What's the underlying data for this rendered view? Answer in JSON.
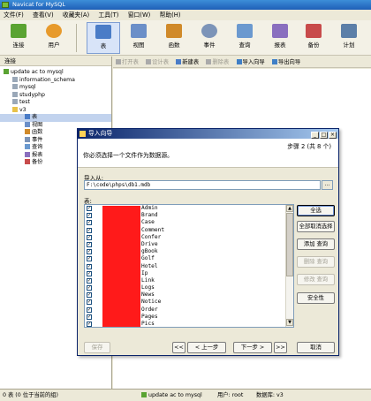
{
  "window": {
    "title": "Navicat for MySQL"
  },
  "menu": [
    "文件(F)",
    "查看(V)",
    "收藏夹(A)",
    "工具(T)",
    "窗口(W)",
    "帮助(H)"
  ],
  "toolbar": {
    "buttons": [
      {
        "label": "连接",
        "icon": "plug-icon",
        "color": "#5aa332"
      },
      {
        "label": "用户",
        "icon": "user-icon",
        "color": "#e79a2c"
      },
      {
        "label": "表",
        "icon": "table-icon",
        "color": "#4a7cc7"
      },
      {
        "label": "视图",
        "icon": "view-icon",
        "color": "#6b8fc8"
      },
      {
        "label": "函数",
        "icon": "function-icon",
        "color": "#d08a2a"
      },
      {
        "label": "事件",
        "icon": "event-icon",
        "color": "#7c94b8"
      },
      {
        "label": "查询",
        "icon": "query-icon",
        "color": "#6b99cf"
      },
      {
        "label": "报表",
        "icon": "report-icon",
        "color": "#8a6fbf"
      },
      {
        "label": "备份",
        "icon": "backup-icon",
        "color": "#c84b4b"
      },
      {
        "label": "计划",
        "icon": "schedule-icon",
        "color": "#5c7fa8"
      }
    ]
  },
  "left_pane": {
    "header": "连接",
    "tree": [
      {
        "label": "update ac to mysql",
        "level": 0
      },
      {
        "label": "information_schema",
        "level": 1
      },
      {
        "label": "mysql",
        "level": 1
      },
      {
        "label": "studyphp",
        "level": 1
      },
      {
        "label": "test",
        "level": 1
      },
      {
        "label": "v3",
        "level": 1
      },
      {
        "label": "表",
        "level": 2
      },
      {
        "label": "视图",
        "level": 2
      },
      {
        "label": "函数",
        "level": 2
      },
      {
        "label": "事件",
        "level": 2
      },
      {
        "label": "查询",
        "level": 2
      },
      {
        "label": "报表",
        "level": 2
      },
      {
        "label": "备份",
        "level": 2
      }
    ]
  },
  "sub_toolbar": {
    "items": [
      {
        "label": "打开表",
        "disabled": true
      },
      {
        "label": "设计表",
        "disabled": true
      },
      {
        "label": "新建表",
        "disabled": false
      },
      {
        "label": "删除表",
        "disabled": true
      },
      {
        "label": "导入向导",
        "disabled": false
      },
      {
        "label": "导出向导",
        "disabled": false
      }
    ]
  },
  "dialog": {
    "title": "导入向导",
    "step": "步骤 2 (共 8 个)",
    "instruction": "你必须选择一个文件作为数据源。",
    "import_from_label": "导入从:",
    "import_path": "F:\\code\\phps\\db1.mdb",
    "browse_label": "...",
    "tables_label": "表:",
    "tables": [
      "Admin",
      "Brand",
      "Case",
      "Comment",
      "Confer",
      "Drive",
      "gBook",
      "Golf",
      "Hotel",
      "Ip",
      "Link",
      "Logs",
      "News",
      "Notice",
      "Order",
      "Pages",
      "Pics"
    ],
    "side_buttons": [
      {
        "label": "全选",
        "disabled": false
      },
      {
        "label": "全部取消选择",
        "disabled": false
      },
      {
        "label": "添加 查询",
        "disabled": false
      },
      {
        "label": "删除 查询",
        "disabled": true
      },
      {
        "label": "修改 查询",
        "disabled": true
      },
      {
        "label": "安全性",
        "disabled": false
      }
    ],
    "save_label": "保存",
    "first_label": "<<",
    "prev_label": "< 上一步",
    "next_label": "下一步 >",
    "last_label": ">>",
    "cancel_label": "取消"
  },
  "status": {
    "left": "0 表 (0 位于当前的组)",
    "connection": "update ac to mysql",
    "user": "用户: root",
    "database": "数据库: v3"
  }
}
